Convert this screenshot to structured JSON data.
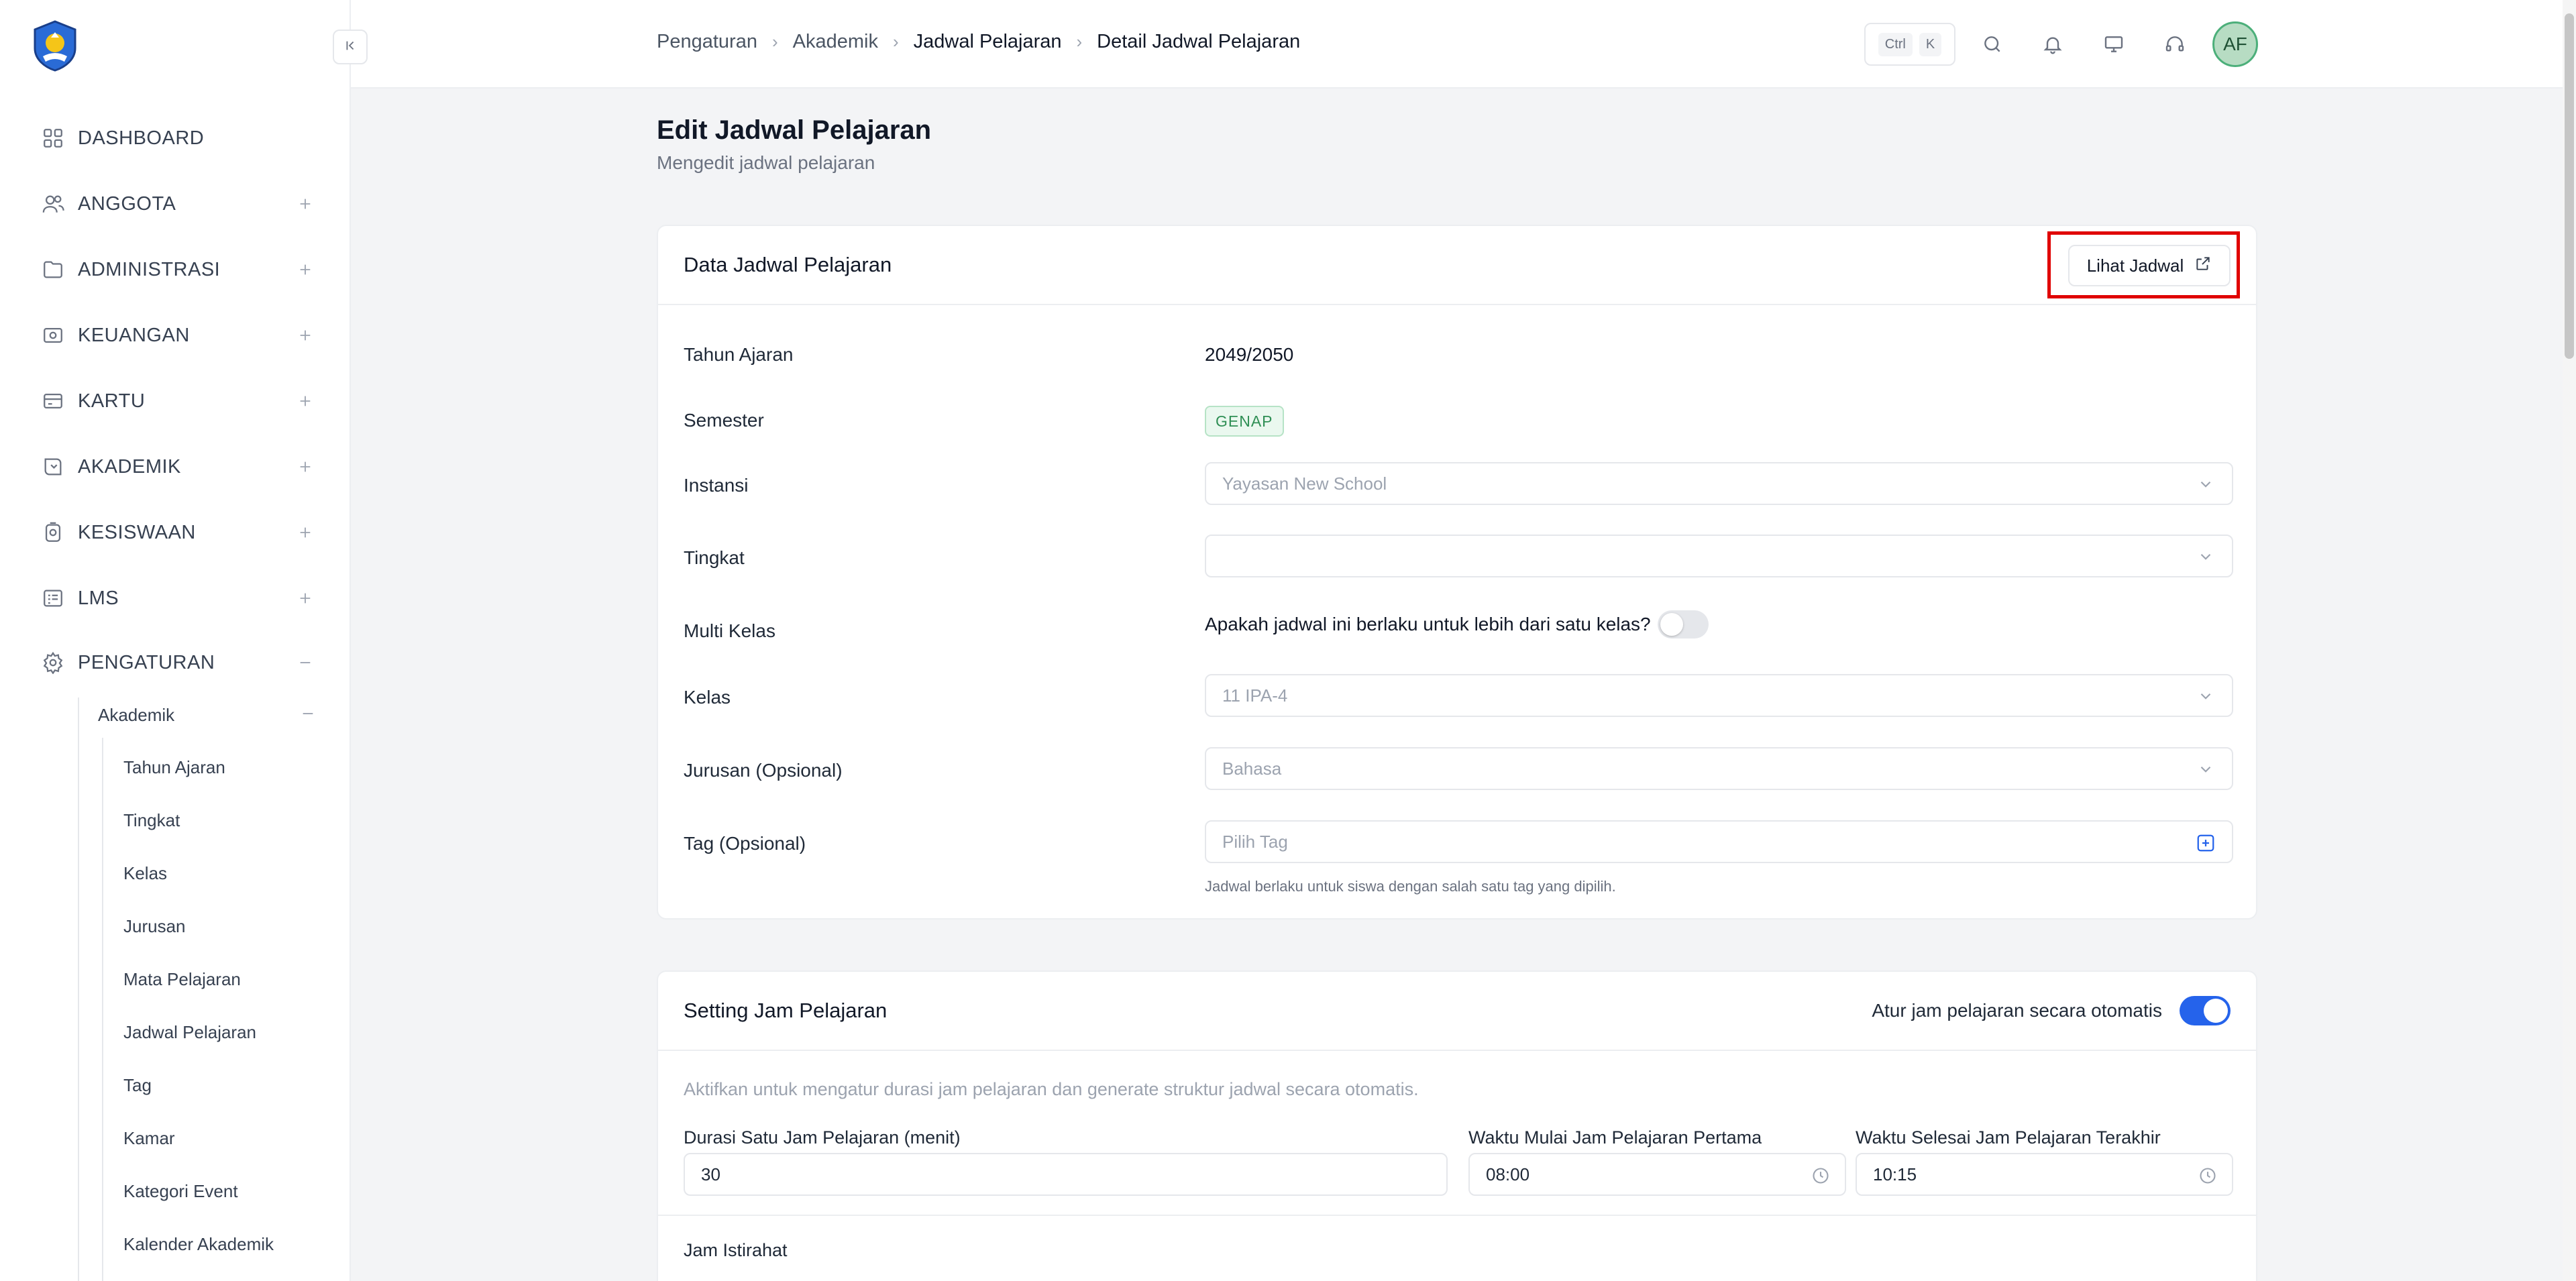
{
  "sidebar": {
    "logo_name": "tut-wuri-handayani-logo",
    "items": [
      {
        "label": "DASHBOARD",
        "icon": "grid-icon",
        "expandable": false
      },
      {
        "label": "ANGGOTA",
        "icon": "users-icon",
        "expandable": true
      },
      {
        "label": "ADMINISTRASI",
        "icon": "folder-icon",
        "expandable": true
      },
      {
        "label": "KEUANGAN",
        "icon": "wallet-icon",
        "expandable": true
      },
      {
        "label": "KARTU",
        "icon": "card-icon",
        "expandable": true
      },
      {
        "label": "AKADEMIK",
        "icon": "academic-icon",
        "expandable": true
      },
      {
        "label": "KESISWAAN",
        "icon": "student-icon",
        "expandable": true
      },
      {
        "label": "LMS",
        "icon": "list-icon",
        "expandable": true
      },
      {
        "label": "PENGATURAN",
        "icon": "gear-icon",
        "expandable": true,
        "expanded": true
      }
    ],
    "submenu_title": "Akademik",
    "submenu_items": [
      "Tahun Ajaran",
      "Tingkat",
      "Kelas",
      "Jurusan",
      "Mata Pelajaran",
      "Jadwal Pelajaran",
      "Tag",
      "Kamar",
      "Kategori Event",
      "Kalender Akademik"
    ]
  },
  "header": {
    "breadcrumb": [
      "Pengaturan",
      "Akademik",
      "Jadwal Pelajaran",
      "Detail Jadwal Pelajaran"
    ],
    "shortcut_keys": [
      "Ctrl",
      "K"
    ],
    "avatar_initials": "AF",
    "icons": [
      "search-icon",
      "bell-icon",
      "monitor-icon",
      "headset-icon"
    ]
  },
  "page": {
    "title": "Edit Jadwal Pelajaran",
    "subtitle": "Mengedit jadwal pelajaran"
  },
  "card1": {
    "title": "Data Jadwal Pelajaran",
    "view_button": "Lihat Jadwal",
    "fields": {
      "tahun_ajaran_label": "Tahun Ajaran",
      "tahun_ajaran_value": "2049/2050",
      "semester_label": "Semester",
      "semester_value": "GENAP",
      "instansi_label": "Instansi",
      "instansi_value": "Yayasan New School",
      "tingkat_label": "Tingkat",
      "tingkat_value": "",
      "multi_kelas_label": "Multi Kelas",
      "multi_kelas_question": "Apakah jadwal ini berlaku untuk lebih dari satu kelas?",
      "multi_kelas_enabled": false,
      "kelas_label": "Kelas",
      "kelas_value": "11 IPA-4",
      "jurusan_label": "Jurusan (Opsional)",
      "jurusan_value": "Bahasa",
      "tag_label": "Tag (Opsional)",
      "tag_placeholder": "Pilih Tag",
      "tag_helper": "Jadwal berlaku untuk siswa dengan salah satu tag yang dipilih."
    }
  },
  "card2": {
    "title": "Setting Jam Pelajaran",
    "auto_label": "Atur jam pelajaran secara otomatis",
    "auto_enabled": true,
    "description": "Aktifkan untuk mengatur durasi jam pelajaran dan generate struktur jadwal secara otomatis.",
    "durasi_label": "Durasi Satu Jam Pelajaran (menit)",
    "durasi_value": "30",
    "mulai_label": "Waktu Mulai Jam Pelajaran Pertama",
    "mulai_value": "08:00",
    "selesai_label": "Waktu Selesai Jam Pelajaran Terakhir",
    "selesai_value": "10:15",
    "istirahat_label": "Jam Istirahat"
  },
  "colors": {
    "accent": "#2563eb",
    "badge_green": "#2f8f55",
    "highlight_red": "#e00000"
  }
}
